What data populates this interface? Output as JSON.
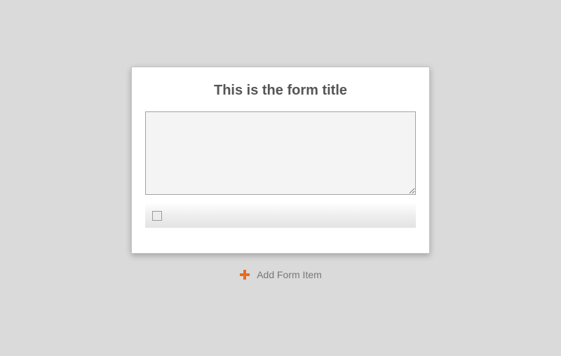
{
  "form": {
    "title": "This is the form title",
    "textarea_value": "",
    "checkbox_checked": false
  },
  "actions": {
    "add_form_item_label": "Add Form Item"
  },
  "colors": {
    "accent": "#e86b1f"
  }
}
